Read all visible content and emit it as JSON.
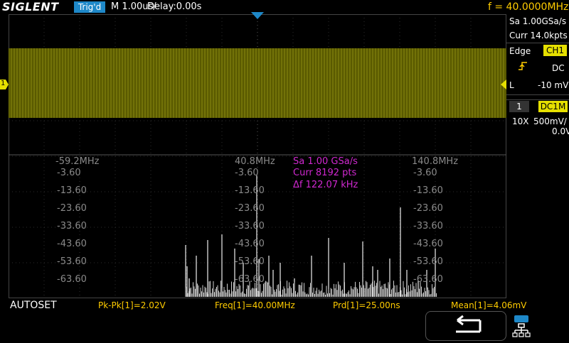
{
  "header": {
    "logo": "SIGLENT",
    "trigger_status": "Trig'd",
    "timebase": "M 1.00us/",
    "delay": "Delay:0.00s",
    "frequency": "f = 40.0000MHz"
  },
  "acquisition": {
    "sample_rate": "Sa 1.00GSa/s",
    "memory": "Curr 14.0kpts"
  },
  "trigger": {
    "type": "Edge",
    "source": "CH1",
    "coupling": "DC",
    "level_label": "L",
    "level": "-10 mV"
  },
  "channel": {
    "number": "1",
    "coupling_impedance": "DC1M",
    "probe": "10X",
    "volts_div": "500mV/",
    "offset": "0.0V"
  },
  "markers": {
    "ch1_marker": "1"
  },
  "fft": {
    "freq_left": "-59.2MHz",
    "freq_center": "40.8MHz",
    "freq_right": "140.8MHz",
    "sample_rate": "Sa 1.00 GSa/s",
    "points": "Curr 8192 pts",
    "resolution": "Δf 122.07 kHz",
    "db_labels": [
      "-3.60",
      "-13.60",
      "-23.60",
      "-33.60",
      "-43.60",
      "-53.60",
      "-63.60"
    ]
  },
  "measurements": {
    "autoset": "AUTOSET",
    "pkpk": "Pk-Pk[1]=2.02V",
    "freq": "Freq[1]=40.00MHz",
    "period": "Prd[1]=25.00ns",
    "mean": "Mean[1]=4.06mV"
  },
  "icons": {
    "back": "back-arrow-icon",
    "network": "network-icon"
  },
  "colors": {
    "trace": "#7a7a00",
    "channel_badge": "#e6e000",
    "trigger_badge": "#1e88c8",
    "fft_text": "#d028d0",
    "measurement_text": "#ffcc00"
  }
}
